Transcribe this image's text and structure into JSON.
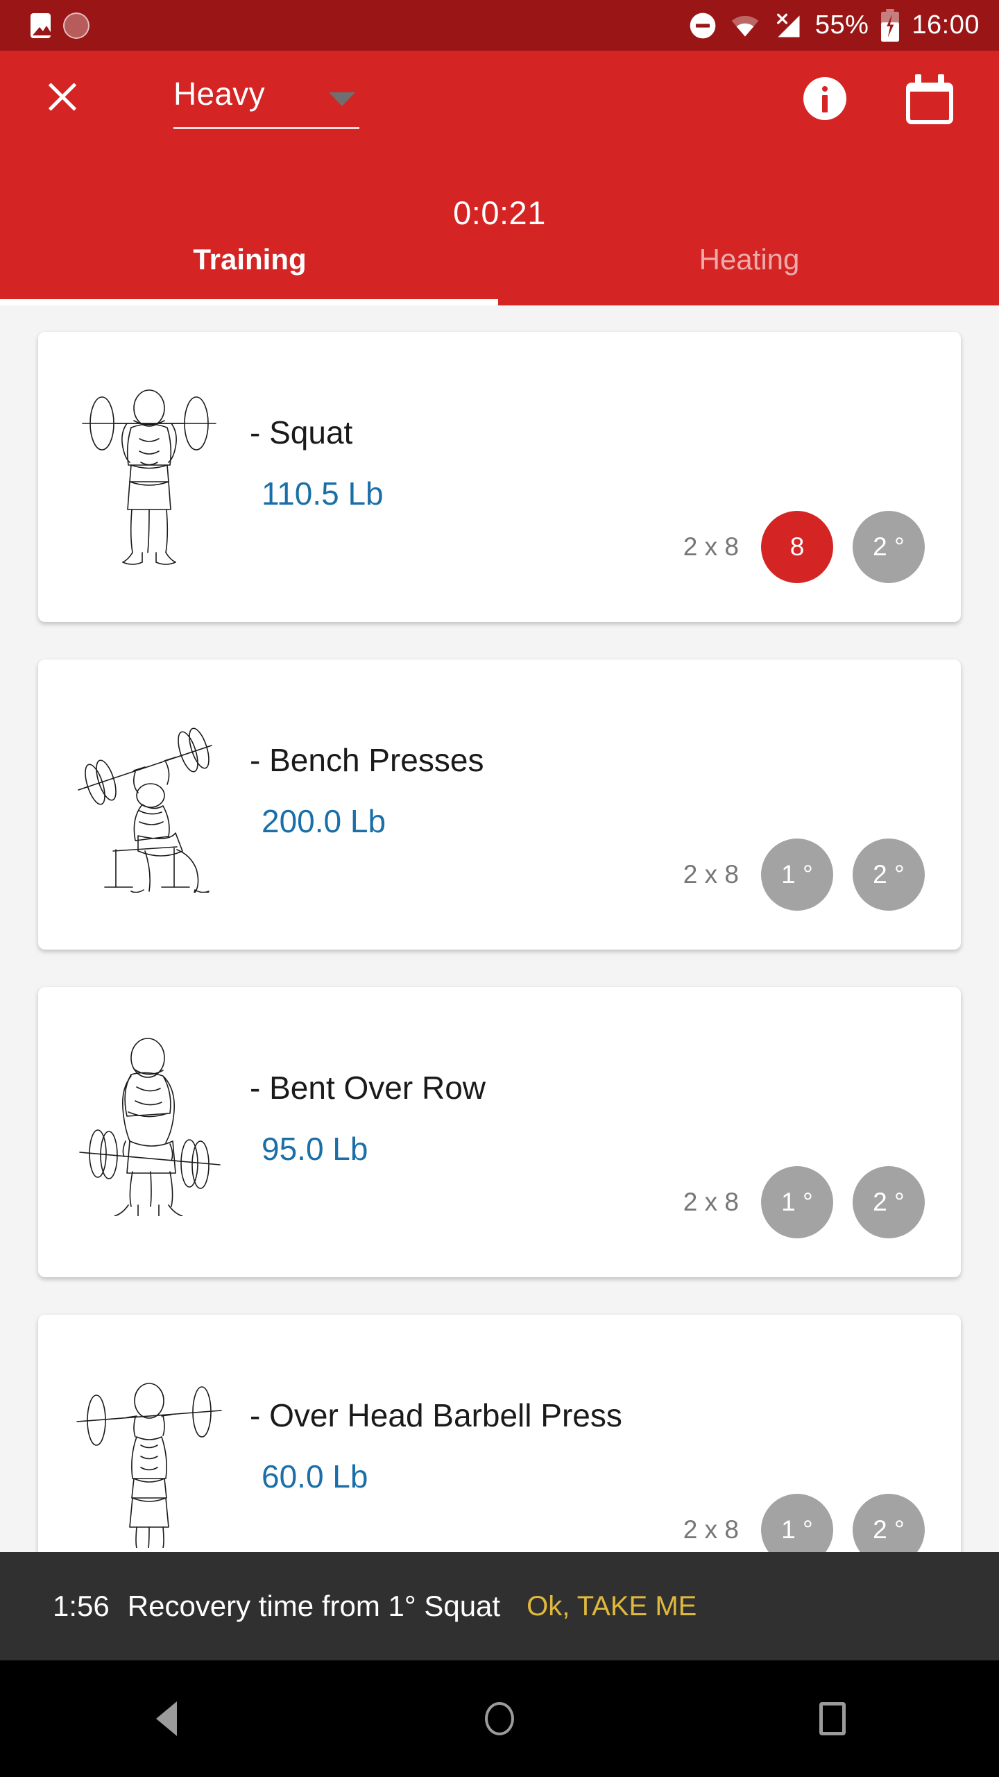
{
  "status_bar": {
    "icons_left": [
      "photo-icon",
      "screen-record-icon"
    ],
    "dnd_icon": "do-not-disturb-icon",
    "wifi_icon": "wifi-icon",
    "signal_icon": "no-sim-signal-icon",
    "battery_percent": "55%",
    "battery_icon": "battery-charging-icon",
    "clock": "16:00",
    "background": "#9a1515"
  },
  "app_bar": {
    "background": "#d42424",
    "close_icon": "close-icon",
    "routine_name": "Heavy",
    "dropdown_caret": "chevron-down-icon",
    "info_icon": "info-icon",
    "calendar_icon": "calendar-icon",
    "timer": "0:0:21",
    "tabs": [
      {
        "label": "Training",
        "active": true
      },
      {
        "label": "Heating",
        "active": false
      }
    ]
  },
  "exercises": [
    {
      "name": "- Squat",
      "weight": "110.5 Lb",
      "sets_label": "2 x 8",
      "illustration": "squat-figure-icon",
      "badges": [
        {
          "label": "8",
          "state": "active",
          "color": "#d42424"
        },
        {
          "label": "2 °",
          "state": "inactive",
          "color": "#a3a3a3"
        }
      ]
    },
    {
      "name": "- Bench Presses",
      "weight": "200.0 Lb",
      "sets_label": "2 x 8",
      "illustration": "bench-press-figure-icon",
      "badges": [
        {
          "label": "1 °",
          "state": "inactive",
          "color": "#a3a3a3"
        },
        {
          "label": "2 °",
          "state": "inactive",
          "color": "#a3a3a3"
        }
      ]
    },
    {
      "name": "- Bent Over Row",
      "weight": "95.0 Lb",
      "sets_label": "2 x 8",
      "illustration": "bent-over-row-figure-icon",
      "badges": [
        {
          "label": "1 °",
          "state": "inactive",
          "color": "#a3a3a3"
        },
        {
          "label": "2 °",
          "state": "inactive",
          "color": "#a3a3a3"
        }
      ]
    },
    {
      "name": "- Over Head Barbell Press",
      "weight": "60.0 Lb",
      "sets_label": "2 x 8",
      "illustration": "overhead-press-figure-icon",
      "badges": [
        {
          "label": "1 °",
          "state": "inactive",
          "color": "#a3a3a3"
        },
        {
          "label": "2 °",
          "state": "inactive",
          "color": "#a3a3a3"
        }
      ]
    }
  ],
  "snackbar": {
    "time": "1:56",
    "message": "Recovery time from 1° Squat",
    "action": "Ok, TAKE ME",
    "action_color": "#e0b93c",
    "background": "#303030"
  },
  "nav_bar": {
    "back_icon": "back-triangle-icon",
    "home_icon": "home-circle-icon",
    "recents_icon": "recents-square-icon"
  },
  "theme": {
    "primary": "#d42424",
    "status_bar": "#9a1515",
    "weight_blue": "#1b6fa8",
    "badge_gray": "#a3a3a3",
    "page_bg": "#f4f4f4"
  }
}
